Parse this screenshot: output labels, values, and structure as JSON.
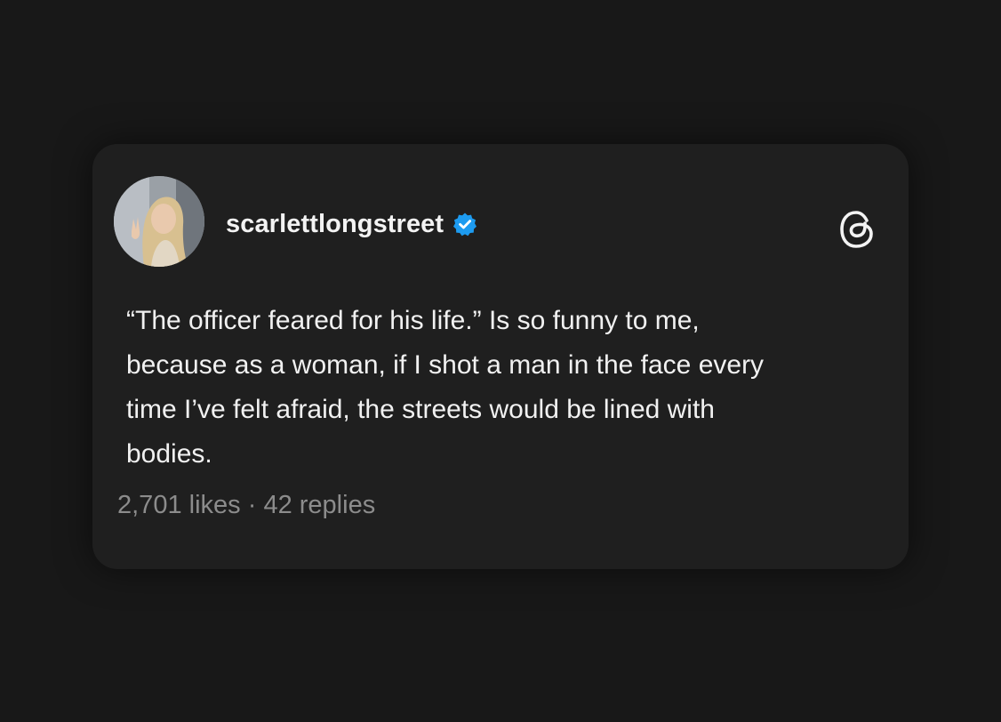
{
  "post": {
    "username": "scarlettlongstreet",
    "verified_icon": "verified-badge-icon",
    "platform_icon": "threads-logo-icon",
    "text_lines": [
      "“The officer feared for his life.” Is so funny to me,",
      "because as a woman, if I shot a man in the face every",
      "time I’ve felt afraid, the streets would be lined with",
      "bodies."
    ],
    "likes": "2,701 likes",
    "separator": "·",
    "replies": "42 replies"
  },
  "colors": {
    "background": "#181818",
    "card": "#1f1f1f",
    "text_primary": "#f1f1f1",
    "text_secondary": "#8c8c8c",
    "verified_blue": "#1d9bf0"
  }
}
